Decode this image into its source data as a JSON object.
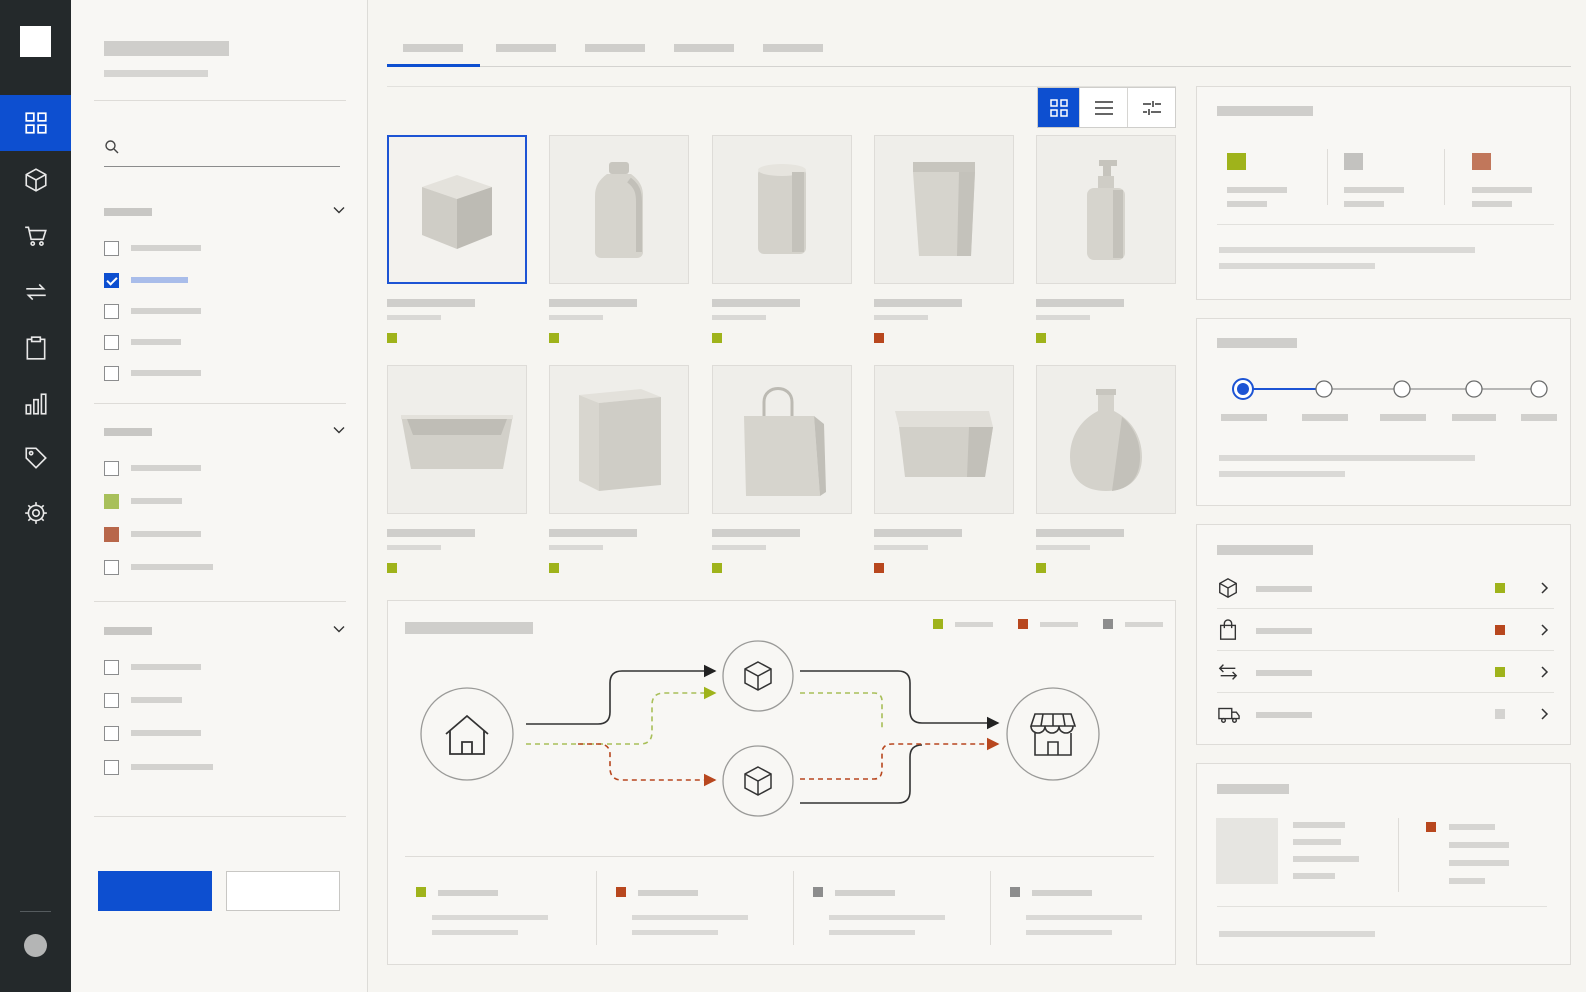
{
  "nav": {
    "items": [
      {
        "icon": "grid-icon",
        "active": true
      },
      {
        "icon": "box-icon",
        "active": false
      },
      {
        "icon": "cart-icon",
        "active": false
      },
      {
        "icon": "transfer-arrows-icon",
        "active": false
      },
      {
        "icon": "clipboard-icon",
        "active": false
      },
      {
        "icon": "bar-chart-icon",
        "active": false
      },
      {
        "icon": "tag-icon",
        "active": false
      },
      {
        "icon": "gear-icon",
        "active": false
      }
    ]
  },
  "filters": {
    "search": {
      "value": "",
      "placeholder": ""
    },
    "groups": [
      {
        "options": [
          {
            "checked": false
          },
          {
            "checked": true
          },
          {
            "checked": false
          },
          {
            "checked": false
          },
          {
            "checked": false
          }
        ]
      },
      {
        "options": [
          {
            "swatch": "none"
          },
          {
            "swatch": "#a8c05a"
          },
          {
            "swatch": "#b8674a"
          },
          {
            "swatch": "none"
          }
        ]
      },
      {
        "options": [
          {
            "checked": false
          },
          {
            "checked": false
          },
          {
            "checked": false
          },
          {
            "checked": false
          }
        ]
      }
    ],
    "apply_label": "",
    "reset_label": ""
  },
  "tabs": {
    "count": 5,
    "active_index": 0
  },
  "view": {
    "active": "grid"
  },
  "products": [
    {
      "shape": "cube",
      "status": "#9fb31b",
      "selected": true
    },
    {
      "shape": "bottle",
      "status": "#9fb31b"
    },
    {
      "shape": "canister",
      "status": "#9fb31b"
    },
    {
      "shape": "pouch",
      "status": "#b8471e"
    },
    {
      "shape": "pump-bottle",
      "status": "#9fb31b"
    },
    {
      "shape": "tray",
      "status": "#9fb31b"
    },
    {
      "shape": "carton",
      "status": "#9fb31b"
    },
    {
      "shape": "shopping-bag",
      "status": "#9fb31b"
    },
    {
      "shape": "lidded-box",
      "status": "#b8471e"
    },
    {
      "shape": "vase",
      "status": "#9fb31b"
    }
  ],
  "flow": {
    "legend": [
      "#9fb31b",
      "#b8471e",
      "#8d8d8d"
    ],
    "nodes": [
      "warehouse-icon",
      "package-icon",
      "package-icon",
      "storefront-icon"
    ],
    "stats": [
      "#9fb31b",
      "#b8471e",
      "#8d8d8d",
      "#8d8d8d"
    ]
  },
  "summary": {
    "swatches": [
      "#9fb31b",
      "#c3c2bf",
      "#c1775b"
    ]
  },
  "progress": {
    "steps": 5,
    "current_step": 1
  },
  "list": {
    "rows": [
      {
        "icon": "box-icon",
        "status": "#9fb31b"
      },
      {
        "icon": "shopping-bag-icon",
        "status": "#b8471e"
      },
      {
        "icon": "transfer-arrows-icon",
        "status": "#9fb31b"
      },
      {
        "icon": "truck-icon",
        "status": "#d4d3d0"
      }
    ]
  },
  "detail": {
    "swatch": "#b8471e"
  },
  "colors": {
    "accent": "#0d4fd0",
    "nav_bg": "#24292b",
    "green": "#9fb31b",
    "orange": "#b8471e",
    "gray": "#8d8d8d"
  }
}
